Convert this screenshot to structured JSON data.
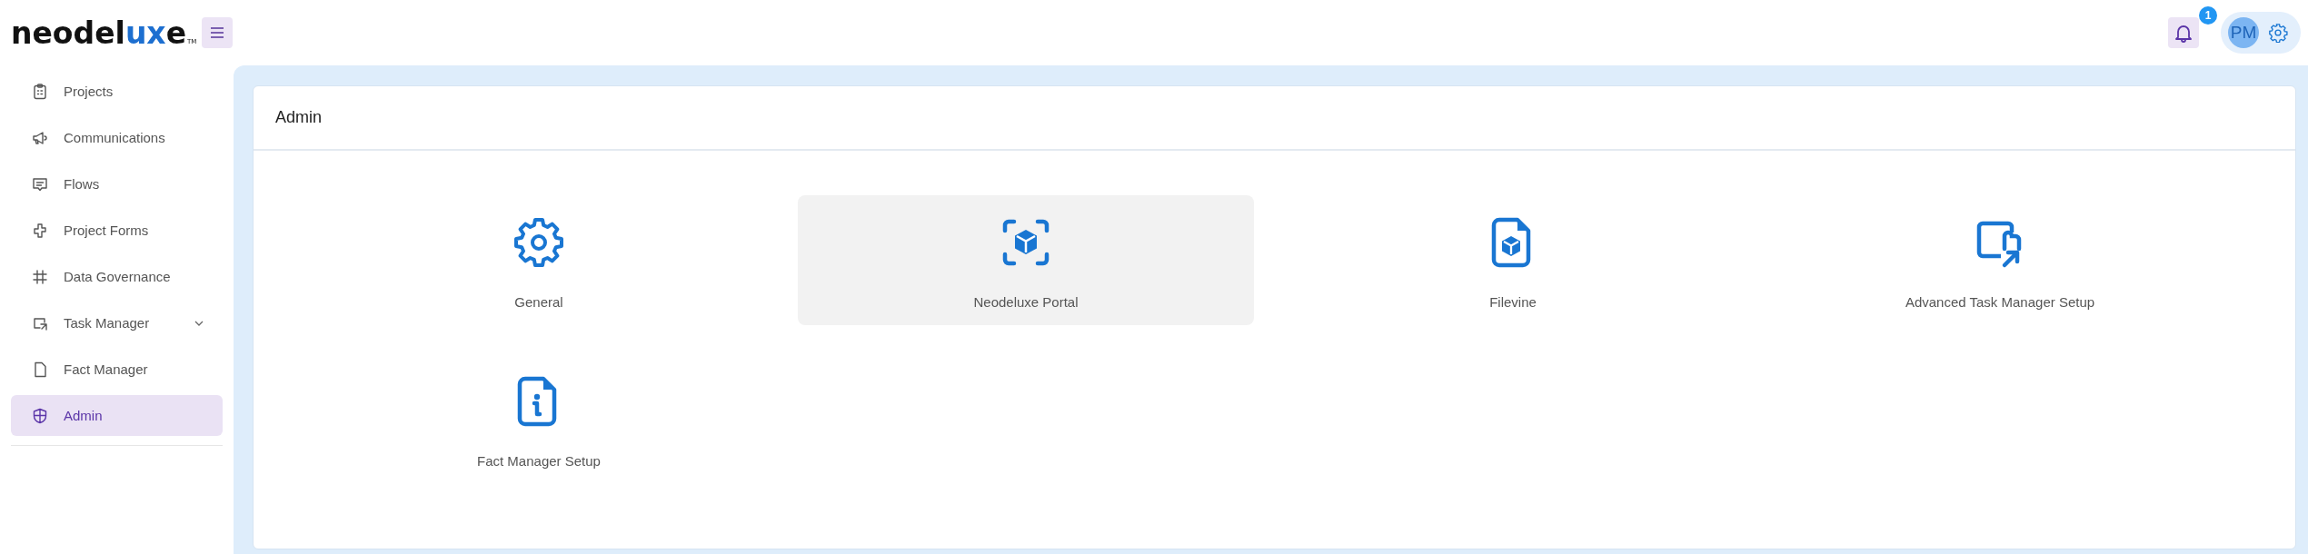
{
  "header": {
    "logo": {
      "dark": "neodel",
      "accent": "ux",
      "rest": "e",
      "tm": "TM"
    },
    "notifications": {
      "count": "1"
    },
    "user": {
      "initials": "PM"
    }
  },
  "sidebar": {
    "items": [
      {
        "label": "Projects",
        "selected": false
      },
      {
        "label": "Communications",
        "selected": false
      },
      {
        "label": "Flows",
        "selected": false
      },
      {
        "label": "Project Forms",
        "selected": false
      },
      {
        "label": "Data Governance",
        "selected": false
      },
      {
        "label": "Task Manager",
        "selected": false,
        "expanded": false
      },
      {
        "label": "Fact Manager",
        "selected": false
      },
      {
        "label": "Admin",
        "selected": true
      }
    ]
  },
  "panel": {
    "title": "Admin",
    "tiles": [
      {
        "label": "General",
        "hovered": false
      },
      {
        "label": "Neodeluxe Portal",
        "hovered": true
      },
      {
        "label": "Filevine",
        "hovered": false
      },
      {
        "label": "Advanced Task Manager Setup",
        "hovered": false
      },
      {
        "label": "Fact Manager Setup",
        "hovered": false
      }
    ]
  }
}
